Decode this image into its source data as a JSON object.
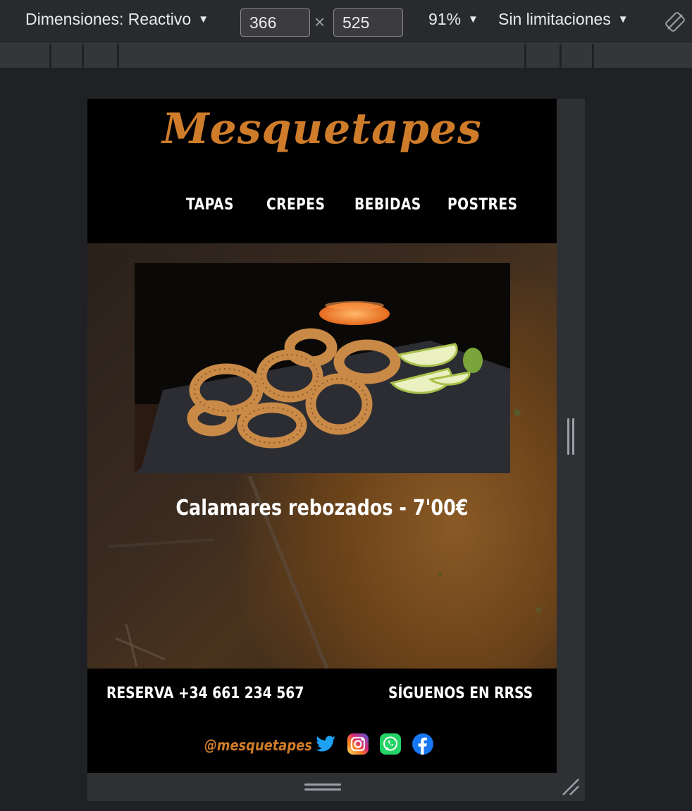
{
  "devtools": {
    "dimensions_label": "Dimensiones: Reactivo",
    "width_value": "366",
    "height_value": "525",
    "zoom": "91%",
    "throttling": "Sin limitaciones"
  },
  "site": {
    "logo": "Mesquetapes",
    "nav": [
      "TAPAS",
      "CREPES",
      "BEBIDAS",
      "POSTRES"
    ],
    "dish_caption": "Calamares rebozados - 7'00€",
    "footer": {
      "reserva": "RESERVA +34 661 234 567",
      "siguenos": "SÍGUENOS EN RRSS",
      "handle": "@mesquetapes"
    }
  },
  "colors": {
    "brand_orange": "#cf7c2a",
    "twitter": "#1da1f2",
    "whatsapp": "#25d366",
    "facebook": "#1877f2"
  },
  "icons": [
    "rotate-icon",
    "twitter-icon",
    "instagram-icon",
    "whatsapp-icon",
    "facebook-icon"
  ]
}
